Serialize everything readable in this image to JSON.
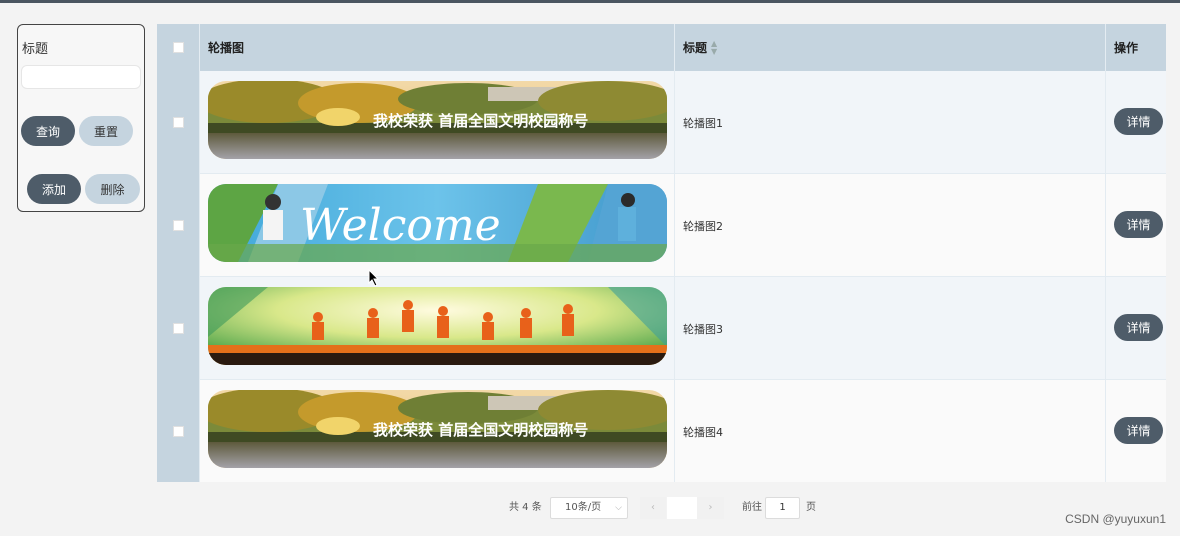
{
  "search": {
    "label": "标题",
    "placeholder": "",
    "query_label": "查询",
    "reset_label": "重置",
    "add_label": "添加",
    "delete_label": "删除"
  },
  "table": {
    "headers": {
      "image": "轮播图",
      "title": "标题",
      "action": "操作"
    },
    "rows": [
      {
        "title": "轮播图1",
        "detail_label": "详情",
        "banner": "campus-banner",
        "banner_text": "我校荣获 首届全国文明校园称号"
      },
      {
        "title": "轮播图2",
        "detail_label": "详情",
        "banner": "welcome-banner",
        "banner_text": "Welcome"
      },
      {
        "title": "轮播图3",
        "detail_label": "详情",
        "banner": "jumping-people-banner",
        "banner_text": ""
      },
      {
        "title": "轮播图4",
        "detail_label": "详情",
        "banner": "campus-banner",
        "banner_text": "我校荣获 首届全国文明校园称号"
      }
    ]
  },
  "pagination": {
    "total": "共 4 条",
    "page_size": "10条/页",
    "goto": "前往",
    "page_input": "1",
    "page_suffix": "页"
  },
  "watermark": "CSDN @yuyuxun1",
  "colors": {
    "accent": "#4e5c69",
    "header_bg": "#c5d4df",
    "light_button": "#c5d4df"
  }
}
